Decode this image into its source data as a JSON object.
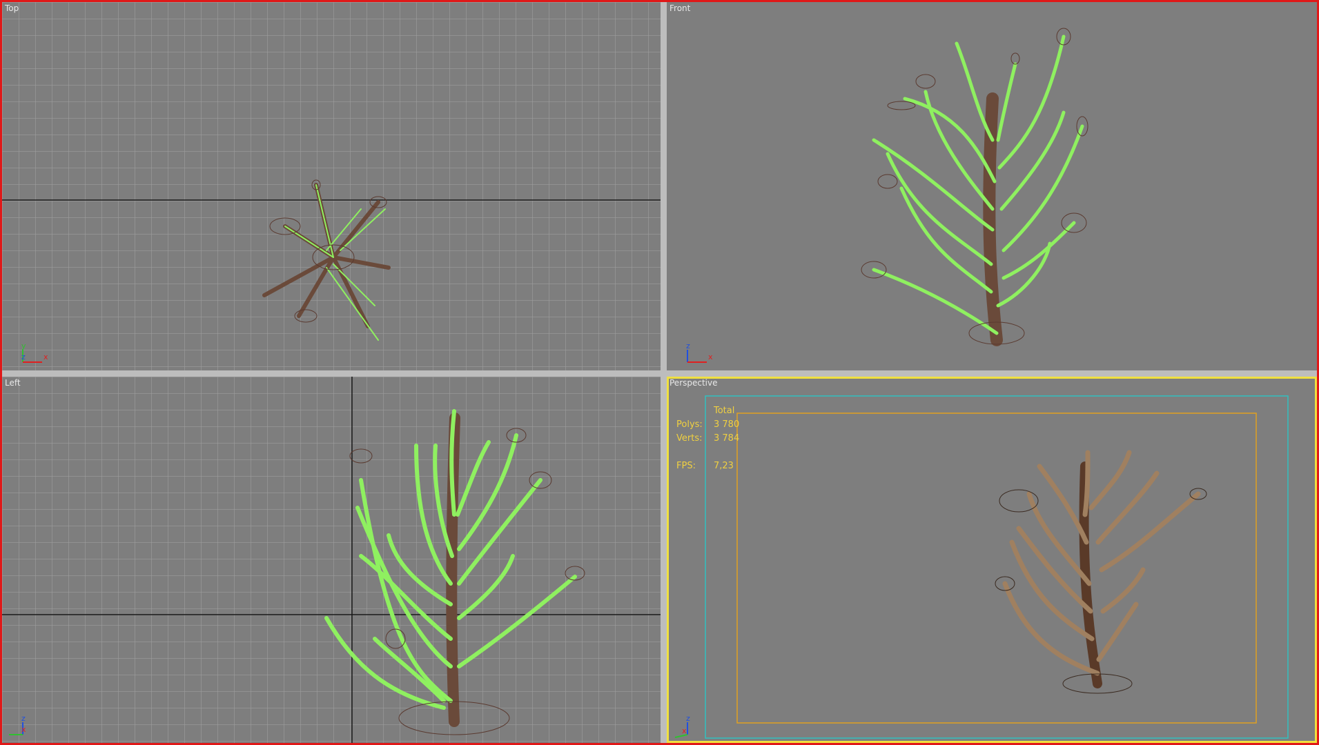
{
  "viewports": {
    "top": {
      "label": "Top"
    },
    "front": {
      "label": "Front"
    },
    "left": {
      "label": "Left"
    },
    "perspective": {
      "label": "Perspective"
    }
  },
  "axis_labels": {
    "top": {
      "a": "y",
      "b": "x",
      "c": "z"
    },
    "front": {
      "a": "z",
      "b": "x"
    },
    "left": {
      "a": "z",
      "b": "x"
    },
    "perspective": {
      "a": "z",
      "b": "x"
    }
  },
  "stats": {
    "header": "Total",
    "polys_label": "Polys:",
    "polys_value": "3 780",
    "verts_label": "Verts:",
    "verts_value": "3 784",
    "fps_label": "FPS:",
    "fps_value": "7,23"
  },
  "colors": {
    "frame": "#e01818",
    "viewport_bg": "#7e7e7e",
    "wire_green": "#8ff060",
    "wire_brown": "#6a4a3a",
    "active_border": "#f0e040",
    "safe_frame_outer": "#30c0c0",
    "safe_frame_inner": "#e0a020",
    "stats_text": "#f0d040"
  }
}
